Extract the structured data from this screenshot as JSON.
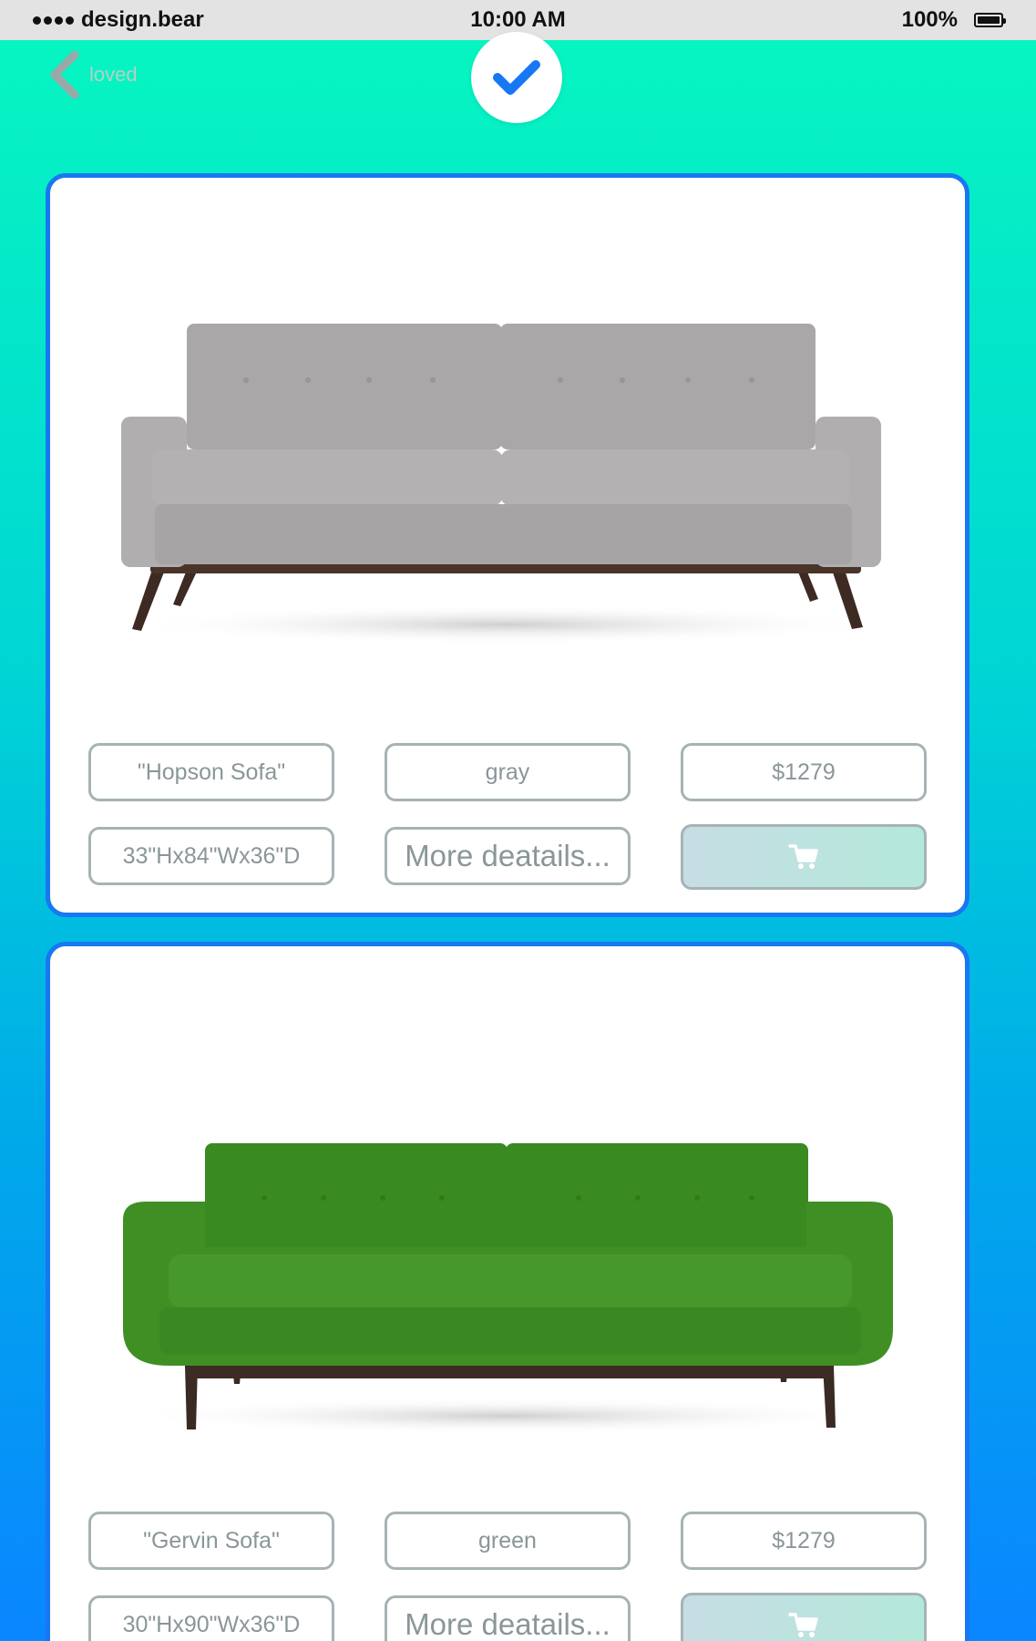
{
  "status_bar": {
    "carrier": "design.bear",
    "time": "10:00 AM",
    "battery": "100%"
  },
  "nav": {
    "back_label": "loved"
  },
  "products": [
    {
      "name": "\"Hopson Sofa\"",
      "color": "gray",
      "price": "$1279",
      "dimensions": "33\"Hx84\"Wx36\"D",
      "details_label": "More deatails...",
      "sofa_color": "#a9a7a8"
    },
    {
      "name": "\"Gervin Sofa\"",
      "color": "green",
      "price": "$1279",
      "dimensions": "30\"Hx90\"Wx36\"D",
      "details_label": "More deatails...",
      "sofa_color": "#3a8a22"
    }
  ],
  "icons": {
    "back": "chevron-left-icon",
    "check": "check-icon",
    "cart": "cart-icon"
  },
  "colors": {
    "accent": "#1877f2",
    "field_border": "#a6b3b5",
    "field_text": "#8a9699"
  }
}
